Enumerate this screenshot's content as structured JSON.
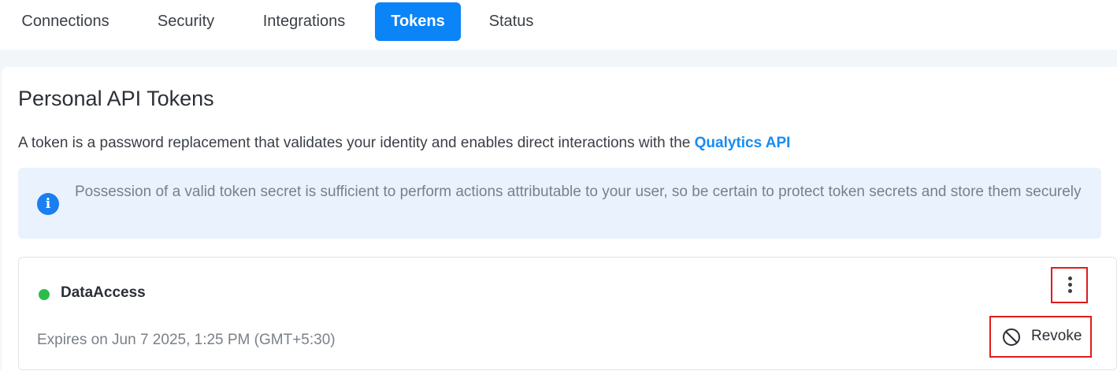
{
  "tabs": [
    {
      "label": "Connections",
      "active": false
    },
    {
      "label": "Security",
      "active": false
    },
    {
      "label": "Integrations",
      "active": false
    },
    {
      "label": "Tokens",
      "active": true
    },
    {
      "label": "Status",
      "active": false
    }
  ],
  "page": {
    "title": "Personal API Tokens",
    "description_prefix": "A token is a password replacement that validates your identity and enables direct interactions with the",
    "description_link": "Qualytics API"
  },
  "alert": {
    "icon": "info-icon",
    "text": "Possession of a valid token secret is sufficient to perform actions attributable to your user, so be certain to protect token secrets and store them securely"
  },
  "token": {
    "name": "DataAccess",
    "status_color": "#2bbd4a",
    "expiry": "Expires on Jun 7 2025, 1:25 PM (GMT+5:30)",
    "menu": {
      "revoke_label": "Revoke",
      "revoke_icon": "block-icon"
    }
  },
  "colors": {
    "accent": "#0a84f7",
    "link": "#1a8cf0",
    "alert_bg": "#eaf2fd",
    "highlight": "#e21b1b"
  }
}
